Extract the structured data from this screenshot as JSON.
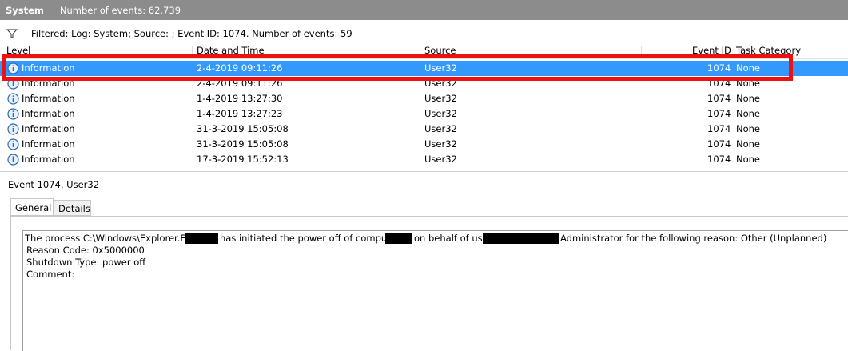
{
  "titlebar": {
    "title": "System",
    "count": "Number of events: 62.739"
  },
  "filter": {
    "text": "Filtered: Log: System; Source: ; Event ID: 1074. Number of events: 59",
    "icon": "funnel-icon"
  },
  "columns": [
    "Level",
    "Date and Time",
    "Source",
    "Event ID",
    "Task Category"
  ],
  "rows": [
    {
      "level": "Information",
      "date": "2-4-2019 09:11:26",
      "source": "User32",
      "id": "1074",
      "task": "None"
    },
    {
      "level": "Information",
      "date": "2-4-2019 09:11:26",
      "source": "User32",
      "id": "1074",
      "task": "None"
    },
    {
      "level": "Information",
      "date": "1-4-2019 13:27:30",
      "source": "User32",
      "id": "1074",
      "task": "None"
    },
    {
      "level": "Information",
      "date": "1-4-2019 13:27:23",
      "source": "User32",
      "id": "1074",
      "task": "None"
    },
    {
      "level": "Information",
      "date": "31-3-2019 15:05:08",
      "source": "User32",
      "id": "1074",
      "task": "None"
    },
    {
      "level": "Information",
      "date": "31-3-2019 15:05:08",
      "source": "User32",
      "id": "1074",
      "task": "None"
    },
    {
      "level": "Information",
      "date": "17-3-2019 15:52:13",
      "source": "User32",
      "id": "1074",
      "task": "None"
    }
  ],
  "detail": {
    "title": "Event 1074, User32",
    "tabs": [
      "General",
      "Details"
    ],
    "msg1a": "The process C:\\Windows\\Explorer.EXE",
    "msg1b": "has initiated the power off of computer",
    "msg1c": "on behalf of user",
    "msg1d": "Administrator for the following reason: Other (Unplanned)",
    "line2": "Reason Code: 0x5000000",
    "line3": "Shutdown Type: power off",
    "line4": "Comment:"
  },
  "colors": {
    "selection": "#3399ff",
    "highlight": "#ee1111",
    "titlebar": "#8c8c8c"
  }
}
